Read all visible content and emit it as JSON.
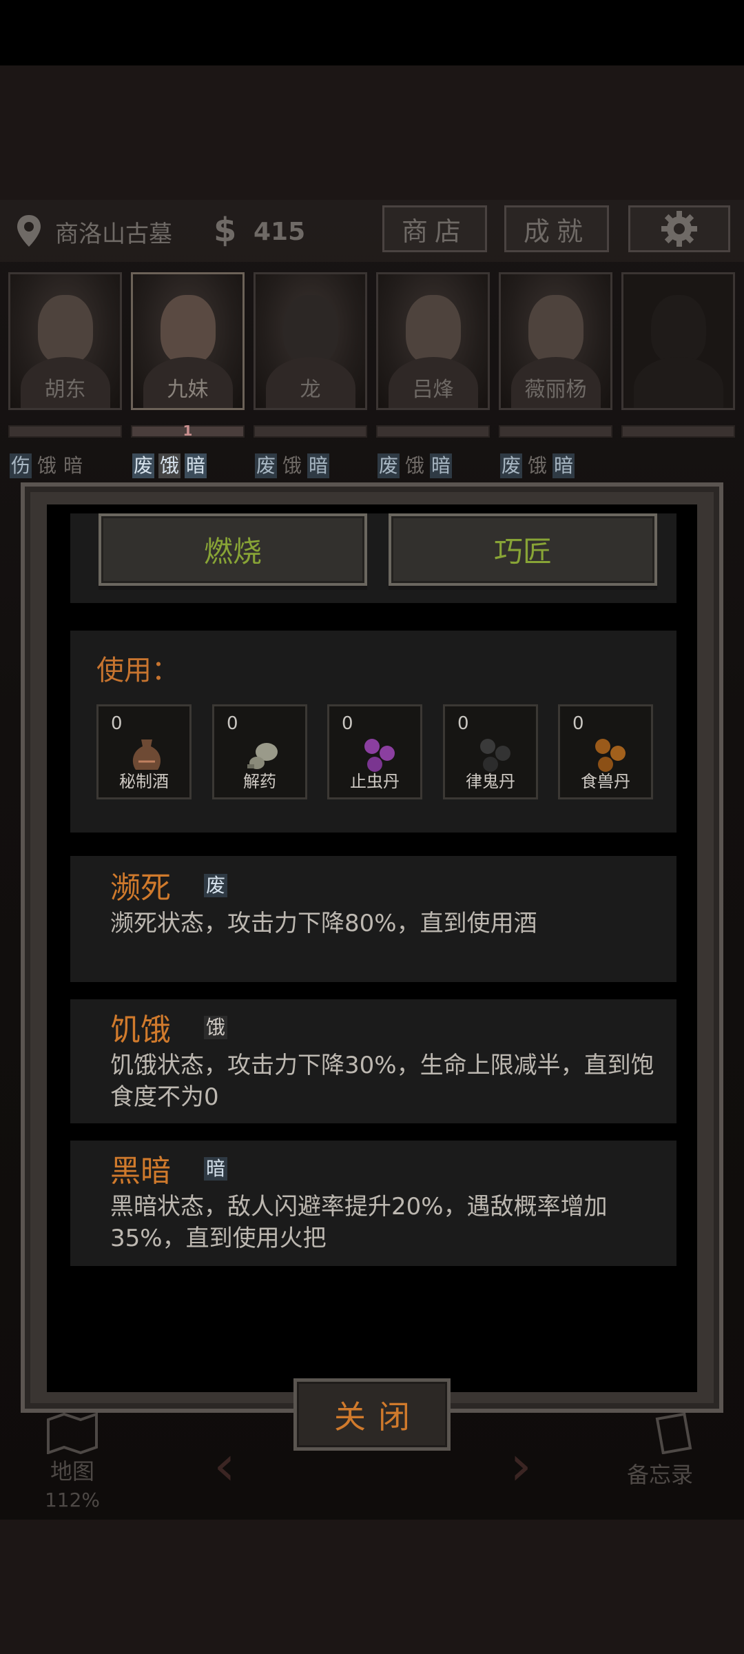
{
  "topbar": {
    "location": "商洛山古墓",
    "money_symbol": "$",
    "money": "415",
    "shop": "商店",
    "achievements": "成就"
  },
  "party": [
    {
      "name": "胡东",
      "tags": [
        "伤",
        "饿",
        "暗"
      ],
      "hp": ""
    },
    {
      "name": "九妹",
      "tags": [
        "废",
        "饿",
        "暗"
      ],
      "hp": "1"
    },
    {
      "name": "龙",
      "tags": [
        "废",
        "饿",
        "暗"
      ],
      "hp": ""
    },
    {
      "name": "吕烽",
      "tags": [
        "废",
        "饿",
        "暗"
      ],
      "hp": ""
    },
    {
      "name": "薇丽杨",
      "tags": [
        "废",
        "饿",
        "暗"
      ],
      "hp": ""
    },
    {
      "name": "",
      "tags": [],
      "hp": ""
    }
  ],
  "modal": {
    "craft_buttons": [
      "燃烧",
      "巧匠"
    ],
    "use_label": "使用：",
    "items": [
      {
        "name": "秘制酒",
        "count": "0",
        "icon": "wine-jar-icon"
      },
      {
        "name": "解药",
        "count": "0",
        "icon": "antidote-gourd-icon"
      },
      {
        "name": "止虫丹",
        "count": "0",
        "icon": "purple-pill-icon"
      },
      {
        "name": "律鬼丹",
        "count": "0",
        "icon": "black-pill-icon"
      },
      {
        "name": "食兽丹",
        "count": "0",
        "icon": "orange-pill-icon"
      }
    ],
    "statuses": [
      {
        "title": "濒死",
        "tag": "废",
        "desc": "濒死状态，攻击力下降80%，直到使用酒"
      },
      {
        "title": "饥饿",
        "tag": "饿",
        "desc": "饥饿状态，攻击力下降30%，生命上限减半，直到饱食度不为0"
      },
      {
        "title": "黑暗",
        "tag": "暗",
        "desc": "黑暗状态，敌人闪避率提升20%，遇敌概率增加35%，直到使用火把"
      }
    ],
    "close": "关闭"
  },
  "bottom": {
    "map": "地图",
    "map_pct": "112%",
    "memo": "备忘录"
  },
  "colors": {
    "accent_orange": "#d07a2c",
    "craft_green": "#88a436",
    "tag_blue": "#2f3a44"
  }
}
